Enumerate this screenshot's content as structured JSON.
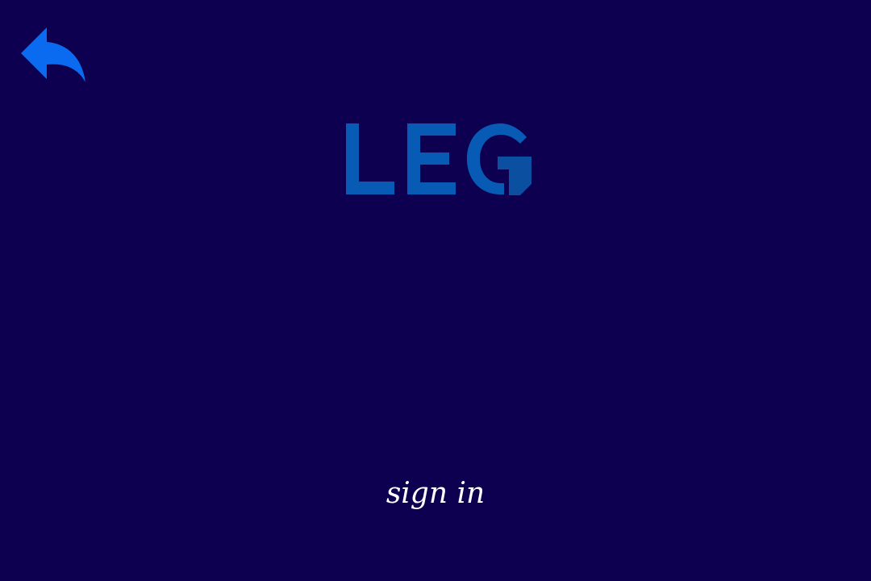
{
  "back": {
    "icon": "reply-arrow-icon",
    "color": "#0a6bf0"
  },
  "logo": {
    "text": "LEG",
    "color": "#075bb5",
    "accent_color": "#0b4fa0"
  },
  "sign_in": {
    "label": "sign in",
    "color": "#ffffff"
  },
  "theme": {
    "background": "#0e0050"
  }
}
